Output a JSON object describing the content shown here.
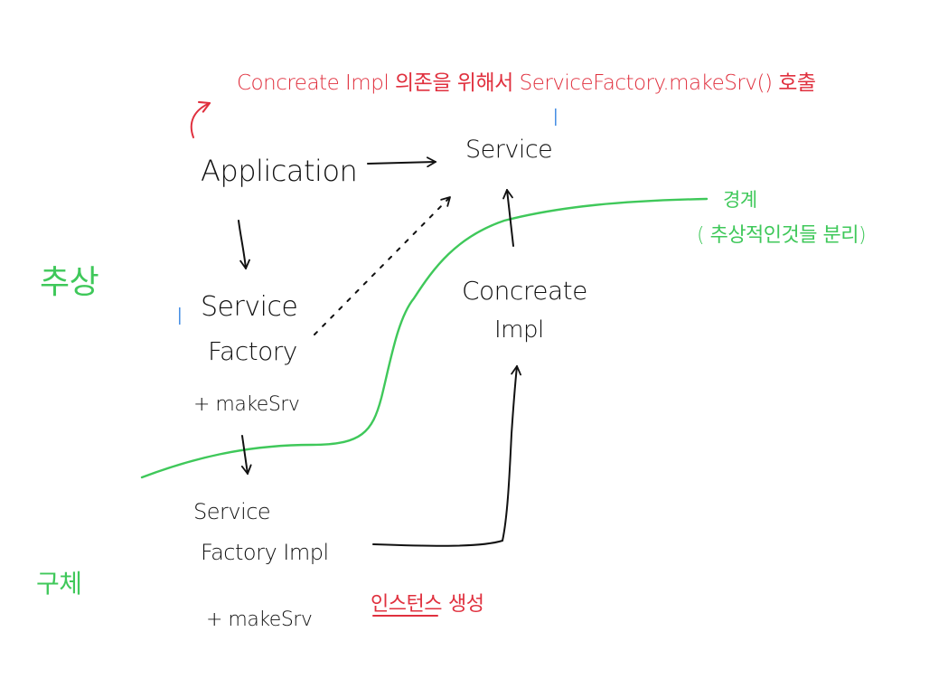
{
  "nodes": {
    "application": "Application",
    "service": "Service",
    "service_factory_line1": "Service",
    "service_factory_line2": "Factory",
    "service_factory_method": "+ makeSrv",
    "concrete_impl_line1": "Concreate",
    "concrete_impl_line2": "Impl",
    "service_factory_impl_line1": "Service",
    "service_factory_impl_line2": "Factory Impl",
    "service_factory_impl_method": "+ makeSrv"
  },
  "interface_markers": {
    "service": "I",
    "service_factory": "I"
  },
  "annotations": {
    "top_note": "Concreate Impl 의존을 위해서 ServiceFactory.makeSrv() 호출",
    "boundary_label": "경계",
    "boundary_note": "( 추상적인것들 분리)",
    "abstract_label": "추상",
    "concrete_label": "구체",
    "instance_note_underlined": "인스턴스",
    "instance_note_rest": "생성"
  },
  "colors": {
    "ink": "#111111",
    "annotation_red": "#e0303e",
    "boundary_green": "#3fc85a",
    "interface_blue": "#2a7de0"
  }
}
